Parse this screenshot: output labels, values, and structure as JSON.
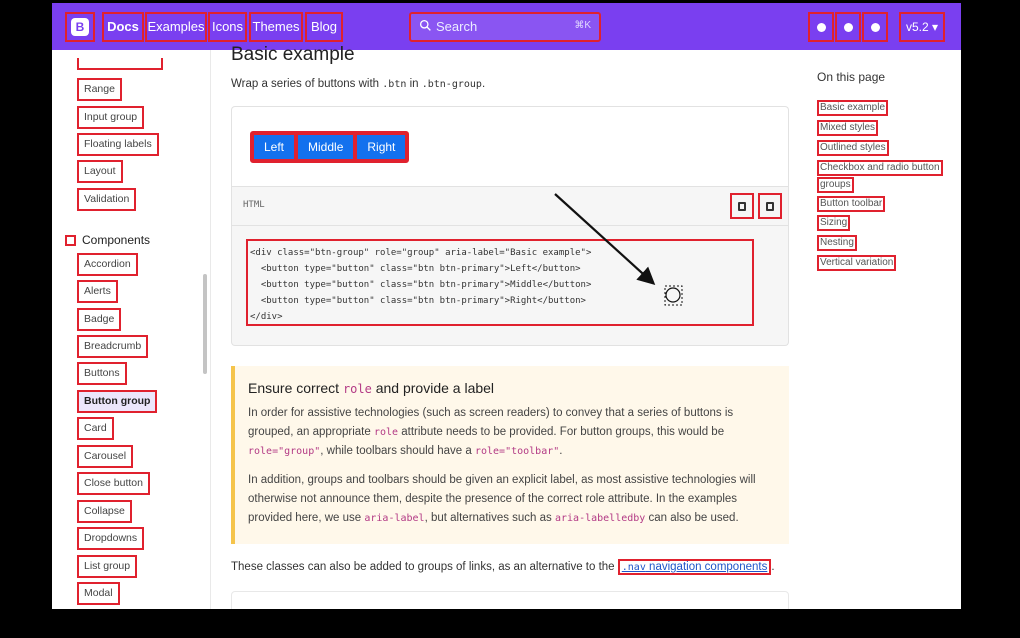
{
  "navbar": {
    "logo_letter": "B",
    "links": [
      "Docs",
      "Examples",
      "Icons",
      "Themes",
      "Blog"
    ],
    "search_placeholder": "Search",
    "search_shortcut": "⌘K",
    "version": "v5.2",
    "social_icons": [
      "github-icon",
      "twitter-icon",
      "opencollective-icon"
    ]
  },
  "sidebar": {
    "forms_items": [
      "Range",
      "Input group",
      "Floating labels",
      "Layout",
      "Validation"
    ],
    "components_title": "Components",
    "components_items": [
      "Accordion",
      "Alerts",
      "Badge",
      "Breadcrumb",
      "Buttons",
      "Button group",
      "Card",
      "Carousel",
      "Close button",
      "Collapse",
      "Dropdowns",
      "List group",
      "Modal"
    ],
    "active_item": "Button group"
  },
  "main": {
    "heading": "Basic example",
    "intro_prefix": "Wrap a series of buttons with ",
    "intro_code1": ".btn",
    "intro_mid": " in ",
    "intro_code2": ".btn-group",
    "intro_suffix": ".",
    "example_buttons": [
      "Left",
      "Middle",
      "Right"
    ],
    "code_lang": "HTML",
    "code_lines": [
      "<div class=\"btn-group\" role=\"group\" aria-label=\"Basic example\">",
      "  <button type=\"button\" class=\"btn btn-primary\">Left</button>",
      "  <button type=\"button\" class=\"btn btn-primary\">Middle</button>",
      "  <button type=\"button\" class=\"btn btn-primary\">Right</button>",
      "</div>"
    ],
    "callout": {
      "title_prefix": "Ensure correct ",
      "title_code": "role",
      "title_suffix": " and provide a label",
      "p1_a": "In order for assistive technologies (such as screen readers) to convey that a series of buttons is grouped, an appropriate ",
      "p1_code1": "role",
      "p1_b": " attribute needs to be provided. For button groups, this would be ",
      "p1_code2": "role=\"group\"",
      "p1_c": ", while toolbars should have a ",
      "p1_code3": "role=\"toolbar\"",
      "p1_d": ".",
      "p2_a": "In addition, groups and toolbars should be given an explicit label, as most assistive technologies will otherwise not announce them, despite the presence of the correct role attribute. In the examples provided here, we use ",
      "p2_code1": "aria-label",
      "p2_b": ", but alternatives such as ",
      "p2_code2": "aria-labelledby",
      "p2_c": " can also be used."
    },
    "footnote_text": "These classes can also be added to groups of links, as an alternative to the ",
    "footnote_link_code": ".nav",
    "footnote_link_text": " navigation components",
    "footnote_end": "."
  },
  "toc": {
    "title": "On this page",
    "items": [
      "Basic example",
      "Mixed styles",
      "Outlined styles",
      "Checkbox and radio button",
      "groups",
      "Button toolbar",
      "Sizing",
      "Nesting",
      "Vertical variation"
    ]
  },
  "colors": {
    "brand": "#7a3ff0",
    "primary_button": "#1371ee",
    "highlight_box": "#e0212e",
    "callout_border": "#f5c44b"
  }
}
